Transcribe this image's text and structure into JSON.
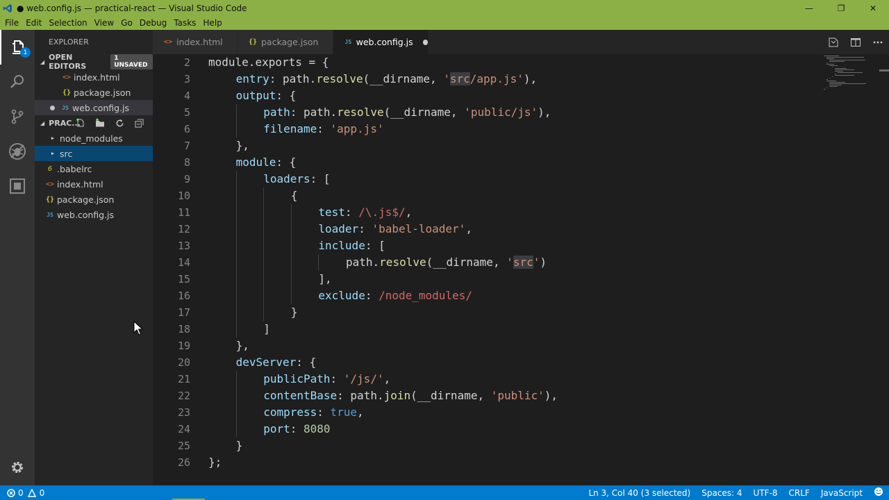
{
  "window": {
    "title": "● web.config.js — practical-react — Visual Studio Code",
    "minimize_glyph": "—",
    "maximize_glyph": "❐",
    "close_glyph": "✕"
  },
  "menu": [
    "File",
    "Edit",
    "Selection",
    "View",
    "Go",
    "Debug",
    "Tasks",
    "Help"
  ],
  "activity": {
    "explorer_badge": "1",
    "icons": [
      "files-icon",
      "search-icon",
      "source-control-icon",
      "debug-icon",
      "extensions-icon",
      "settings-gear-icon"
    ]
  },
  "sidebar": {
    "title": "EXPLORER",
    "open_editors_label": "OPEN EDITORS",
    "unsaved_badge": "1 UNSAVED",
    "open_editors": [
      {
        "name": "index.html",
        "icon": "<>",
        "type": "html"
      },
      {
        "name": "package.json",
        "icon": "{}",
        "type": "json"
      },
      {
        "name": "web.config.js",
        "icon": "JS",
        "type": "js"
      }
    ],
    "project_label": "PRAC...",
    "folders": [
      {
        "name": "node_modules",
        "icon": "▶"
      },
      {
        "name": "src",
        "icon": "▶"
      }
    ],
    "files": [
      {
        "name": ".babelrc",
        "icon": "6",
        "type": "babel"
      },
      {
        "name": "index.html",
        "icon": "<>",
        "type": "html"
      },
      {
        "name": "package.json",
        "icon": "{}",
        "type": "json"
      },
      {
        "name": "web.config.js",
        "icon": "JS",
        "type": "js"
      }
    ]
  },
  "tabs": [
    {
      "name": "index.html",
      "icon": "<>",
      "type": "html"
    },
    {
      "name": "package.json",
      "icon": "{}",
      "type": "json"
    },
    {
      "name": "web.config.js",
      "icon": "JS",
      "type": "js"
    }
  ],
  "editor": {
    "lines": [
      {
        "n": "2",
        "i": 0,
        "t": [
          [
            "module",
            ""
          ],
          [
            ".",
            ""
          ],
          [
            "exports",
            ""
          ],
          [
            " = {",
            ""
          ]
        ]
      },
      {
        "n": "3",
        "i": 1,
        "t": [
          [
            "entry",
            "p"
          ],
          [
            ": ",
            ""
          ],
          [
            "path",
            ""
          ],
          [
            ".",
            ""
          ],
          [
            "resolve",
            "f"
          ],
          [
            "(__dirname, ",
            ""
          ],
          [
            "'",
            "s"
          ],
          [
            "src",
            "sh"
          ],
          [
            "/app.js'",
            "s"
          ],
          [
            "),",
            ""
          ]
        ]
      },
      {
        "n": "4",
        "i": 1,
        "t": [
          [
            "output",
            "p"
          ],
          [
            ": {",
            ""
          ]
        ]
      },
      {
        "n": "5",
        "i": 2,
        "t": [
          [
            "path",
            "p"
          ],
          [
            ": ",
            ""
          ],
          [
            "path",
            ""
          ],
          [
            ".",
            ""
          ],
          [
            "resolve",
            "f"
          ],
          [
            "(__dirname, ",
            ""
          ],
          [
            "'public/js'",
            "s"
          ],
          [
            "),",
            ""
          ]
        ]
      },
      {
        "n": "6",
        "i": 2,
        "t": [
          [
            "filename",
            "p"
          ],
          [
            ": ",
            ""
          ],
          [
            "'app.js'",
            "s"
          ]
        ]
      },
      {
        "n": "7",
        "i": 1,
        "t": [
          [
            "},",
            ""
          ]
        ]
      },
      {
        "n": "8",
        "i": 1,
        "t": [
          [
            "module",
            "p"
          ],
          [
            ": {",
            ""
          ]
        ]
      },
      {
        "n": "9",
        "i": 2,
        "t": [
          [
            "loaders",
            "p"
          ],
          [
            ": [",
            ""
          ]
        ]
      },
      {
        "n": "10",
        "i": 3,
        "t": [
          [
            "{",
            ""
          ]
        ]
      },
      {
        "n": "11",
        "i": 4,
        "t": [
          [
            "test",
            "p"
          ],
          [
            ": ",
            ""
          ],
          [
            "/\\.js$/",
            "r"
          ],
          [
            ",",
            ""
          ]
        ]
      },
      {
        "n": "12",
        "i": 4,
        "t": [
          [
            "loader",
            "p"
          ],
          [
            ": ",
            ""
          ],
          [
            "'babel-loader'",
            "s"
          ],
          [
            ",",
            ""
          ]
        ]
      },
      {
        "n": "13",
        "i": 4,
        "t": [
          [
            "include",
            "p"
          ],
          [
            ": [",
            ""
          ]
        ]
      },
      {
        "n": "14",
        "i": 5,
        "t": [
          [
            "path",
            ""
          ],
          [
            ".",
            ""
          ],
          [
            "resolve",
            "f"
          ],
          [
            "(__dirname, ",
            ""
          ],
          [
            "'",
            "s"
          ],
          [
            "src",
            "sh"
          ],
          [
            "'",
            "s"
          ],
          [
            ")",
            ""
          ]
        ]
      },
      {
        "n": "15",
        "i": 4,
        "t": [
          [
            "],",
            ""
          ]
        ]
      },
      {
        "n": "16",
        "i": 4,
        "t": [
          [
            "exclude",
            "p"
          ],
          [
            ": ",
            ""
          ],
          [
            "/node_modules/",
            "r"
          ]
        ]
      },
      {
        "n": "17",
        "i": 3,
        "t": [
          [
            "}",
            ""
          ]
        ]
      },
      {
        "n": "18",
        "i": 2,
        "t": [
          [
            "]",
            ""
          ]
        ]
      },
      {
        "n": "19",
        "i": 1,
        "t": [
          [
            "},",
            ""
          ]
        ]
      },
      {
        "n": "20",
        "i": 1,
        "t": [
          [
            "devServer",
            "p"
          ],
          [
            ": {",
            ""
          ]
        ]
      },
      {
        "n": "21",
        "i": 2,
        "t": [
          [
            "publicPath",
            "p"
          ],
          [
            ": ",
            ""
          ],
          [
            "'/js/'",
            "s"
          ],
          [
            ",",
            ""
          ]
        ]
      },
      {
        "n": "22",
        "i": 2,
        "t": [
          [
            "contentBase",
            "p"
          ],
          [
            ": ",
            ""
          ],
          [
            "path",
            ""
          ],
          [
            ".",
            ""
          ],
          [
            "join",
            "f"
          ],
          [
            "(__dirname, ",
            ""
          ],
          [
            "'public'",
            "s"
          ],
          [
            "),",
            ""
          ]
        ]
      },
      {
        "n": "23",
        "i": 2,
        "t": [
          [
            "compress",
            "p"
          ],
          [
            ": ",
            ""
          ],
          [
            "true",
            "k"
          ],
          [
            ",",
            ""
          ]
        ]
      },
      {
        "n": "24",
        "i": 2,
        "t": [
          [
            "port",
            "p"
          ],
          [
            ": ",
            ""
          ],
          [
            "8080",
            "n"
          ]
        ]
      },
      {
        "n": "25",
        "i": 1,
        "t": [
          [
            "}",
            ""
          ]
        ]
      },
      {
        "n": "26",
        "i": 0,
        "t": [
          [
            "};",
            ""
          ]
        ]
      }
    ]
  },
  "colors": {
    "titlebar": "#8db046",
    "statusbar": "#007acc",
    "property": "#9cdcfe",
    "string": "#ce9178",
    "regex": "#d16969",
    "keyword": "#569cd6",
    "number": "#b5cea8",
    "function": "#dcdcaa"
  },
  "status": {
    "errors": "0",
    "warnings": "0",
    "position": "Ln 3, Col 40 (3 selected)",
    "spaces": "Spaces: 4",
    "encoding": "UTF-8",
    "eol": "CRLF",
    "language": "JavaScript"
  }
}
